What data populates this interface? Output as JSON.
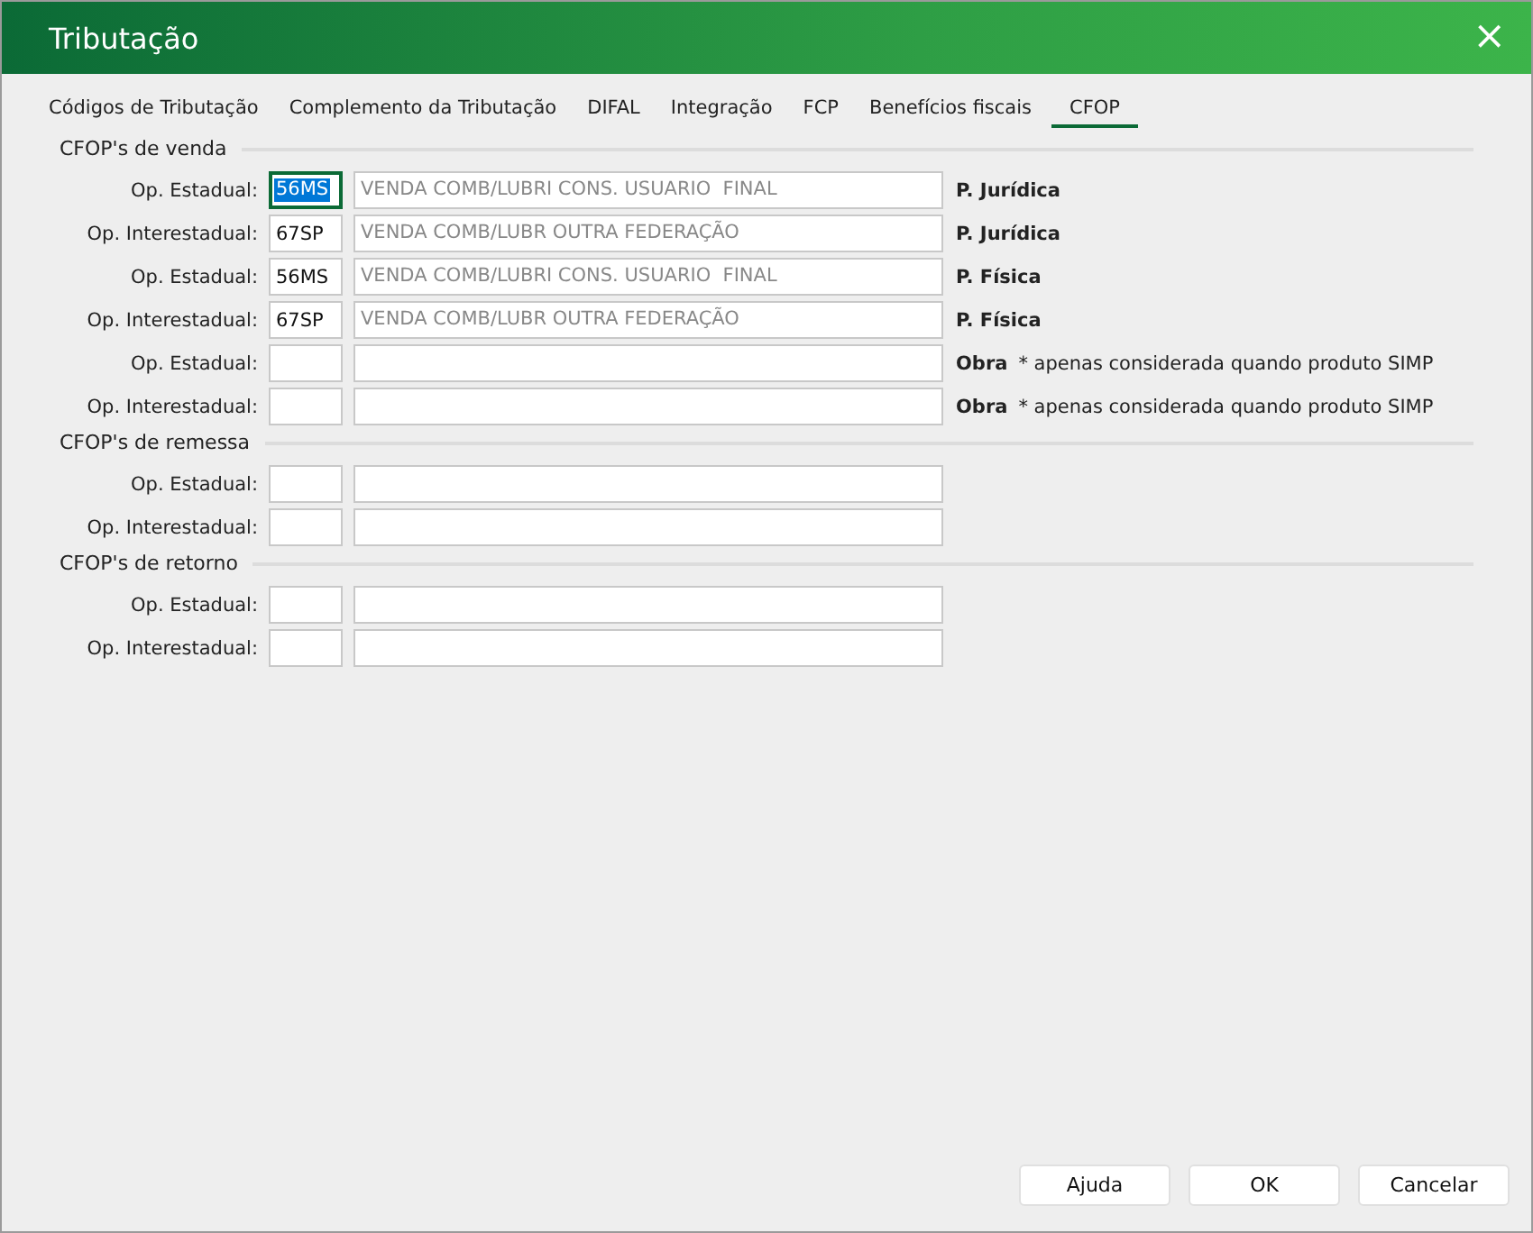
{
  "window": {
    "title": "Tributação",
    "close": "×"
  },
  "tabs": [
    {
      "label": "Códigos de Tributação",
      "selected": false
    },
    {
      "label": "Complemento da Tributação",
      "selected": false
    },
    {
      "label": "DIFAL",
      "selected": false
    },
    {
      "label": "Integração",
      "selected": false
    },
    {
      "label": "FCP",
      "selected": false
    },
    {
      "label": "Benefícios fiscais",
      "selected": false
    },
    {
      "label": "CFOP",
      "selected": true
    }
  ],
  "sections": [
    {
      "title": "CFOP's de venda",
      "rows": [
        {
          "label": "Op. Estadual:",
          "code": "56MS",
          "focused": true,
          "description": "VENDA COMB/LUBRI CONS. USUARIO  FINAL",
          "note": "P. Jurídica"
        },
        {
          "label": "Op. Interestadual:",
          "code": "67SP",
          "focused": false,
          "description": "VENDA COMB/LUBR OUTRA FEDERAÇÃO",
          "note": "P. Jurídica"
        },
        {
          "label": "Op. Estadual:",
          "code": "56MS",
          "focused": false,
          "description": "VENDA COMB/LUBRI CONS. USUARIO  FINAL",
          "note": "P. Física"
        },
        {
          "label": "Op. Interestadual:",
          "code": "67SP",
          "focused": false,
          "description": "VENDA COMB/LUBR OUTRA FEDERAÇÃO",
          "note": "P. Física"
        },
        {
          "label": "Op. Estadual:",
          "focused": false,
          "note": "Obra",
          "hint": "* apenas considerada quando produto SIMP"
        },
        {
          "label": "Op. Interestadual:",
          "focused": false,
          "note": "Obra",
          "hint": "* apenas considerada quando produto SIMP"
        }
      ]
    },
    {
      "title": "CFOP's de remessa",
      "rows": [
        {
          "label": "Op. Estadual:",
          "focused": false
        },
        {
          "label": "Op. Interestadual:",
          "focused": false
        }
      ]
    },
    {
      "title": "CFOP's de retorno",
      "rows": [
        {
          "label": "Op. Estadual:",
          "focused": false
        },
        {
          "label": "Op. Interestadual:",
          "focused": false
        }
      ]
    }
  ],
  "buttons": [
    "Ajuda",
    "OK",
    "Cancelar"
  ]
}
